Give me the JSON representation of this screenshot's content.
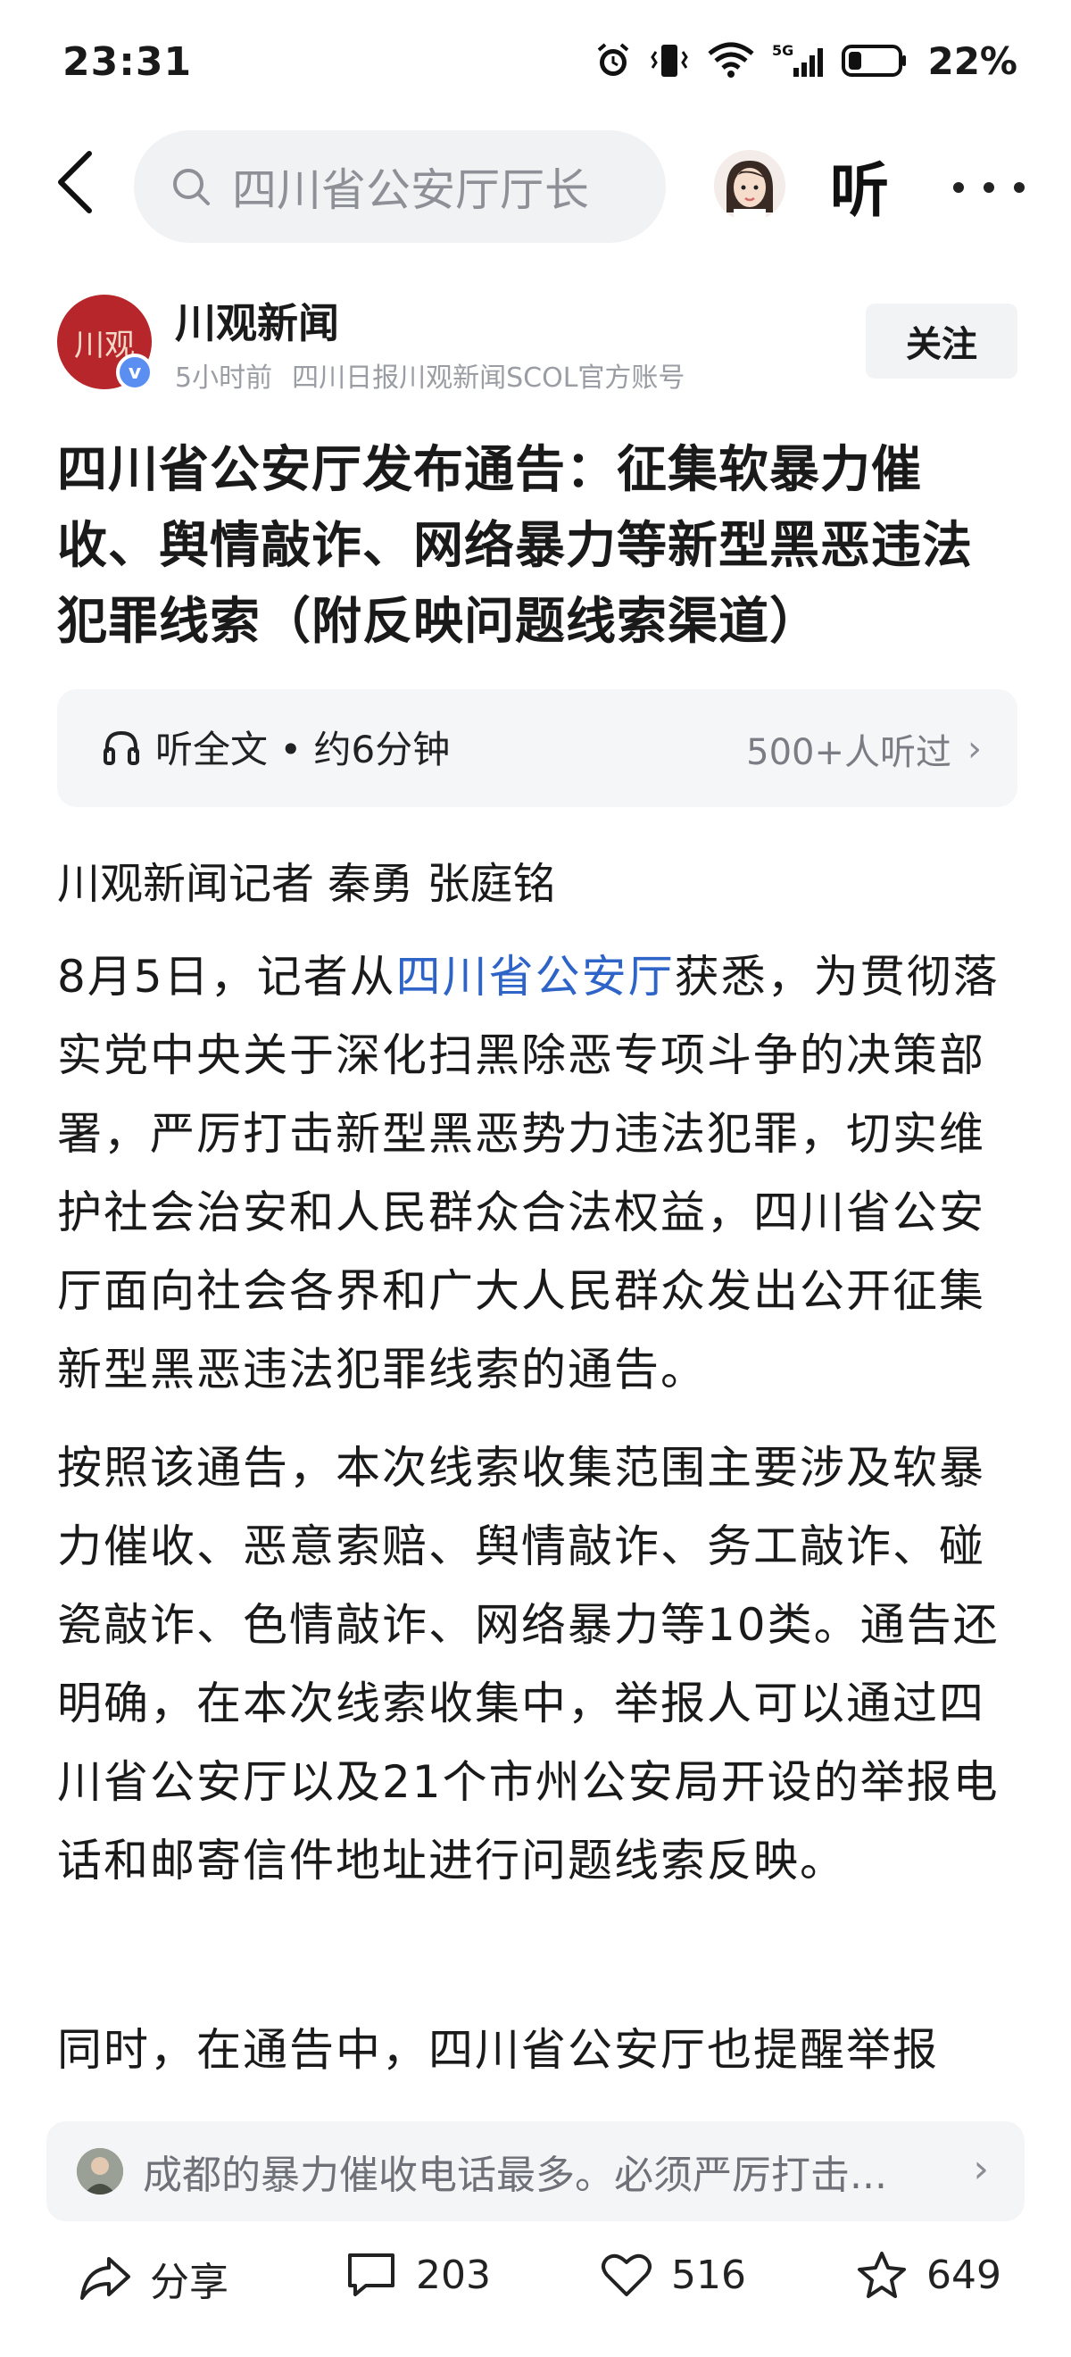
{
  "status": {
    "time": "23:31",
    "battery_pct": "22%",
    "network": "5G",
    "icons": [
      "alarm-icon",
      "vibrate-icon",
      "wifi-icon",
      "signal-5g-icon",
      "battery-icon"
    ]
  },
  "nav": {
    "search_placeholder": "四川省公安厅厅长",
    "listen_label": "听"
  },
  "author": {
    "logo_text": "川观",
    "name": "川观新闻",
    "time_ago": "5小时前",
    "description": "四川日报川观新闻SCOL官方账号",
    "follow_label": "关注"
  },
  "article": {
    "title": "四川省公安厅发布通告：征集软暴力催收、舆情敲诈、网络暴力等新型黑恶违法犯罪线索（附反映问题线索渠道）",
    "listen_card": {
      "label": "听全文 • 约6分钟",
      "listeners": "500+人听过"
    },
    "byline": "川观新闻记者 秦勇 张庭铭",
    "p1_prefix": "8月5日，记者从",
    "p1_link": "四川省公安厅",
    "p1_suffix": "获悉，为贯彻落实党中央关于深化扫黑除恶专项斗争的决策部署，严厉打击新型黑恶势力违法犯罪，切实维护社会治安和人民群众合法权益，四川省公安厅面向社会各界和广大人民群众发出公开征集新型黑恶违法犯罪线索的通告。",
    "p2": "按照该通告，本次线索收集范围主要涉及软暴力催收、恶意索赔、舆情敲诈、务工敲诈、碰瓷敲诈、色情敲诈、网络暴力等10类。通告还明确，在本次线索收集中，举报人可以通过四川省公安厅以及21个市州公安局开设的举报电话和邮寄信件地址进行问题线索反映。",
    "p3": "同时，在通告中，四川省公安厅也提醒举报"
  },
  "comment_preview": {
    "text": "成都的暴力催收电话最多。必须严厉打击..."
  },
  "actions": {
    "share_label": "分享",
    "comment_count": "203",
    "like_count": "516",
    "favorite_count": "649"
  },
  "colors": {
    "link": "#2e64c8",
    "brand_logo": "#b6262a",
    "verify": "#5a8ef0"
  }
}
